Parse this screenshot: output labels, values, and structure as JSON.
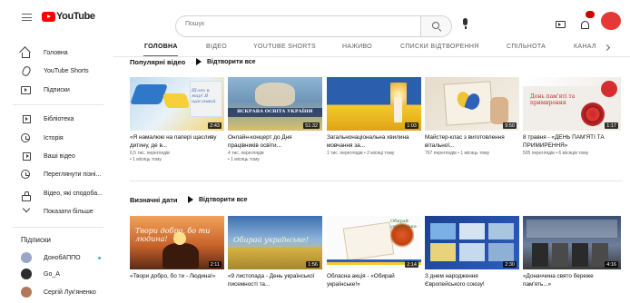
{
  "header": {
    "logo_text": "YouTube",
    "search_placeholder": "Пошук"
  },
  "sidebar": {
    "items": [
      {
        "label": "Головна"
      },
      {
        "label": "YouTube Shorts"
      },
      {
        "label": "Підписки"
      },
      {
        "label": "Бібліотека"
      },
      {
        "label": "Історія"
      },
      {
        "label": "Ваші відео"
      },
      {
        "label": "Переглянути пізні..."
      },
      {
        "label": "Відео, які сподоба..."
      },
      {
        "label": "Показати більше"
      }
    ],
    "subscriptions_title": "Підписки",
    "subscriptions": [
      {
        "label": "ДонобАППО"
      },
      {
        "label": "Go_A"
      },
      {
        "label": "Сергій Лук'яненко"
      }
    ]
  },
  "tabs": [
    "ГОЛОВНА",
    "ВІДЕО",
    "YOUTUBE SHORTS",
    "НАЖИВО",
    "СПИСКИ ВІДТВОРЕННЯ",
    "СПІЛЬНОТА",
    "КАНАЛ"
  ],
  "sections": [
    {
      "title": "Популярні відео",
      "play_all": "Відтворити все",
      "videos": [
        {
          "title": "«Я намалюю на папері щасливу дитину, де в...",
          "meta_line1": "6,5 тис. переглядів",
          "meta_line2": "• 1 місяць тому",
          "duration": "2:43",
          "thumb_text": "Шлях в мир! Я щасливий"
        },
        {
          "title": "Онлайн-концерт до Дня працівників освіти...",
          "meta_line1": "4 тис. переглядів",
          "meta_line2": "• 1 місяць тому",
          "duration": "51:32",
          "thumb_text": "ЯСКРАВА ОСВІТА УКРАЇНИ"
        },
        {
          "title": "Загальнонаціональна хвилина мовчання за...",
          "meta_line1": "1 тис. переглядів • 2 місяці тому",
          "meta_line2": "",
          "duration": "1:03",
          "thumb_text": ""
        },
        {
          "title": "Майстер-клас з виготовлення вітальної...",
          "meta_line1": "767 переглядів • 1 місяць тому",
          "meta_line2": "",
          "duration": "9:50",
          "thumb_text": ""
        },
        {
          "title": "8 травня - «ДЕНЬ ПАМ'ЯТІ ТА ПРИМИРЕННЯ»",
          "meta_line1": "505 переглядів • 6 місяців тому",
          "meta_line2": "",
          "duration": "1:17",
          "thumb_text": "День пам'яті та примирення"
        }
      ]
    },
    {
      "title": "Визначні дати",
      "play_all": "Відтворити все",
      "videos": [
        {
          "title": "«Твори добро, бо ти - Людина!»",
          "meta_line1": "",
          "meta_line2": "",
          "duration": "2:11",
          "thumb_text": "Твори добро, бо ти людина!"
        },
        {
          "title": "«9 листопада - День української писемності та...",
          "meta_line1": "",
          "meta_line2": "",
          "duration": "1:56",
          "thumb_text": "Обирай українське!"
        },
        {
          "title": "Обласна акція - «Обирай українське!»",
          "meta_line1": "",
          "meta_line2": "",
          "duration": "2:14",
          "thumb_text": "Обирай українське"
        },
        {
          "title": "З днем народження Європейського союзу!",
          "meta_line1": "",
          "meta_line2": "",
          "duration": "2:30",
          "thumb_text": ""
        },
        {
          "title": "«Доначчина свято береже пам'ять...»",
          "meta_line1": "",
          "meta_line2": "",
          "duration": "4:16",
          "thumb_text": ""
        }
      ]
    }
  ],
  "colors": {
    "brand_red": "#ff0000",
    "text_primary": "#0f0f0f",
    "text_secondary": "#606060",
    "divider": "#e5e5e5"
  }
}
